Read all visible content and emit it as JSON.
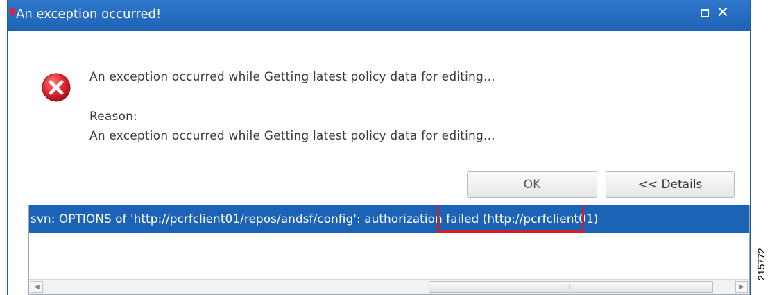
{
  "dialog": {
    "title": "An exception occurred!",
    "maximize_icon": "maximize-icon",
    "close_icon": "close-icon",
    "error_icon": "error-icon",
    "message": "An exception occurred while Getting latest policy data for editing...",
    "reason_label": "Reason:",
    "reason_text": "An exception occurred while Getting latest policy data for editing...",
    "buttons": {
      "ok_label": "OK",
      "details_label": "<< Details"
    },
    "details": {
      "prefix": "svn: OPTIONS of 'http://pcrfclient01/repos/andsf/config': ",
      "highlighted": "authorization failed",
      "suffix": " (http://pcrfclient01)"
    },
    "scrollbar": {
      "left_arrow": "◀",
      "right_arrow": "▶",
      "grip": "III"
    }
  },
  "figure_id": "215772",
  "colors": {
    "titlebar": "#1e63b5",
    "selection": "#1c63b8",
    "highlight_border": "#c8212e",
    "error_red": "#d9232e"
  }
}
